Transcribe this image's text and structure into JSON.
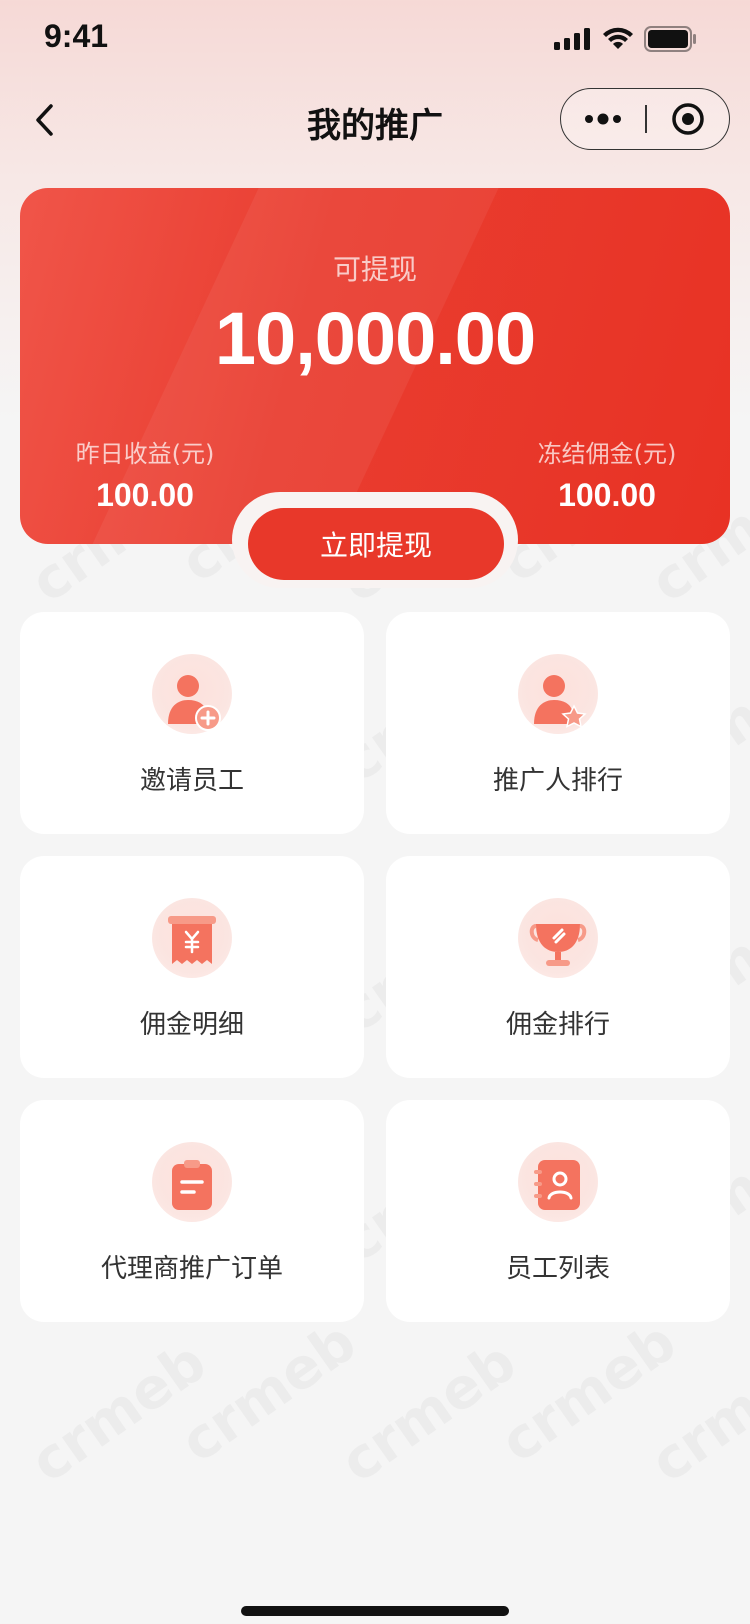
{
  "status_bar": {
    "time": "9:41"
  },
  "nav": {
    "title": "我的推广"
  },
  "balance": {
    "available_label": "可提现",
    "available_amount": "10,000.00",
    "yesterday_label": "昨日收益(元)",
    "yesterday_value": "100.00",
    "frozen_label": "冻结佣金(元)",
    "frozen_value": "100.00",
    "withdraw_label": "立即提现"
  },
  "menu": [
    {
      "label": "邀请员工",
      "icon": "invite-user-icon"
    },
    {
      "label": "推广人排行",
      "icon": "promoter-rank-icon"
    },
    {
      "label": "佣金明细",
      "icon": "commission-detail-icon"
    },
    {
      "label": "佣金排行",
      "icon": "commission-rank-icon"
    },
    {
      "label": "代理商推广订单",
      "icon": "agent-order-icon"
    },
    {
      "label": "员工列表",
      "icon": "staff-list-icon"
    }
  ],
  "watermark": "crmeb",
  "colors": {
    "accent": "#e8382a",
    "icon": "#f4735f"
  }
}
